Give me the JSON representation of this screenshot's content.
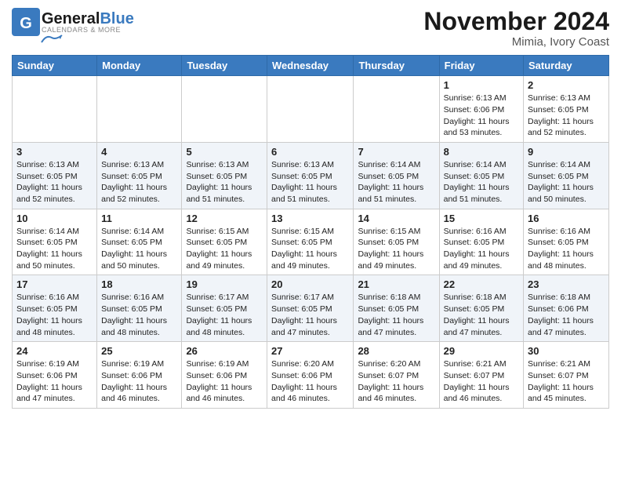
{
  "header": {
    "logo_general": "General",
    "logo_blue": "Blue",
    "month_title": "November 2024",
    "location": "Mimia, Ivory Coast"
  },
  "days_of_week": [
    "Sunday",
    "Monday",
    "Tuesday",
    "Wednesday",
    "Thursday",
    "Friday",
    "Saturday"
  ],
  "weeks": [
    [
      {
        "day": "",
        "info": ""
      },
      {
        "day": "",
        "info": ""
      },
      {
        "day": "",
        "info": ""
      },
      {
        "day": "",
        "info": ""
      },
      {
        "day": "",
        "info": ""
      },
      {
        "day": "1",
        "info": "Sunrise: 6:13 AM\nSunset: 6:06 PM\nDaylight: 11 hours\nand 53 minutes."
      },
      {
        "day": "2",
        "info": "Sunrise: 6:13 AM\nSunset: 6:05 PM\nDaylight: 11 hours\nand 52 minutes."
      }
    ],
    [
      {
        "day": "3",
        "info": "Sunrise: 6:13 AM\nSunset: 6:05 PM\nDaylight: 11 hours\nand 52 minutes."
      },
      {
        "day": "4",
        "info": "Sunrise: 6:13 AM\nSunset: 6:05 PM\nDaylight: 11 hours\nand 52 minutes."
      },
      {
        "day": "5",
        "info": "Sunrise: 6:13 AM\nSunset: 6:05 PM\nDaylight: 11 hours\nand 51 minutes."
      },
      {
        "day": "6",
        "info": "Sunrise: 6:13 AM\nSunset: 6:05 PM\nDaylight: 11 hours\nand 51 minutes."
      },
      {
        "day": "7",
        "info": "Sunrise: 6:14 AM\nSunset: 6:05 PM\nDaylight: 11 hours\nand 51 minutes."
      },
      {
        "day": "8",
        "info": "Sunrise: 6:14 AM\nSunset: 6:05 PM\nDaylight: 11 hours\nand 51 minutes."
      },
      {
        "day": "9",
        "info": "Sunrise: 6:14 AM\nSunset: 6:05 PM\nDaylight: 11 hours\nand 50 minutes."
      }
    ],
    [
      {
        "day": "10",
        "info": "Sunrise: 6:14 AM\nSunset: 6:05 PM\nDaylight: 11 hours\nand 50 minutes."
      },
      {
        "day": "11",
        "info": "Sunrise: 6:14 AM\nSunset: 6:05 PM\nDaylight: 11 hours\nand 50 minutes."
      },
      {
        "day": "12",
        "info": "Sunrise: 6:15 AM\nSunset: 6:05 PM\nDaylight: 11 hours\nand 49 minutes."
      },
      {
        "day": "13",
        "info": "Sunrise: 6:15 AM\nSunset: 6:05 PM\nDaylight: 11 hours\nand 49 minutes."
      },
      {
        "day": "14",
        "info": "Sunrise: 6:15 AM\nSunset: 6:05 PM\nDaylight: 11 hours\nand 49 minutes."
      },
      {
        "day": "15",
        "info": "Sunrise: 6:16 AM\nSunset: 6:05 PM\nDaylight: 11 hours\nand 49 minutes."
      },
      {
        "day": "16",
        "info": "Sunrise: 6:16 AM\nSunset: 6:05 PM\nDaylight: 11 hours\nand 48 minutes."
      }
    ],
    [
      {
        "day": "17",
        "info": "Sunrise: 6:16 AM\nSunset: 6:05 PM\nDaylight: 11 hours\nand 48 minutes."
      },
      {
        "day": "18",
        "info": "Sunrise: 6:16 AM\nSunset: 6:05 PM\nDaylight: 11 hours\nand 48 minutes."
      },
      {
        "day": "19",
        "info": "Sunrise: 6:17 AM\nSunset: 6:05 PM\nDaylight: 11 hours\nand 48 minutes."
      },
      {
        "day": "20",
        "info": "Sunrise: 6:17 AM\nSunset: 6:05 PM\nDaylight: 11 hours\nand 47 minutes."
      },
      {
        "day": "21",
        "info": "Sunrise: 6:18 AM\nSunset: 6:05 PM\nDaylight: 11 hours\nand 47 minutes."
      },
      {
        "day": "22",
        "info": "Sunrise: 6:18 AM\nSunset: 6:05 PM\nDaylight: 11 hours\nand 47 minutes."
      },
      {
        "day": "23",
        "info": "Sunrise: 6:18 AM\nSunset: 6:06 PM\nDaylight: 11 hours\nand 47 minutes."
      }
    ],
    [
      {
        "day": "24",
        "info": "Sunrise: 6:19 AM\nSunset: 6:06 PM\nDaylight: 11 hours\nand 47 minutes."
      },
      {
        "day": "25",
        "info": "Sunrise: 6:19 AM\nSunset: 6:06 PM\nDaylight: 11 hours\nand 46 minutes."
      },
      {
        "day": "26",
        "info": "Sunrise: 6:19 AM\nSunset: 6:06 PM\nDaylight: 11 hours\nand 46 minutes."
      },
      {
        "day": "27",
        "info": "Sunrise: 6:20 AM\nSunset: 6:06 PM\nDaylight: 11 hours\nand 46 minutes."
      },
      {
        "day": "28",
        "info": "Sunrise: 6:20 AM\nSunset: 6:07 PM\nDaylight: 11 hours\nand 46 minutes."
      },
      {
        "day": "29",
        "info": "Sunrise: 6:21 AM\nSunset: 6:07 PM\nDaylight: 11 hours\nand 46 minutes."
      },
      {
        "day": "30",
        "info": "Sunrise: 6:21 AM\nSunset: 6:07 PM\nDaylight: 11 hours\nand 45 minutes."
      }
    ]
  ]
}
